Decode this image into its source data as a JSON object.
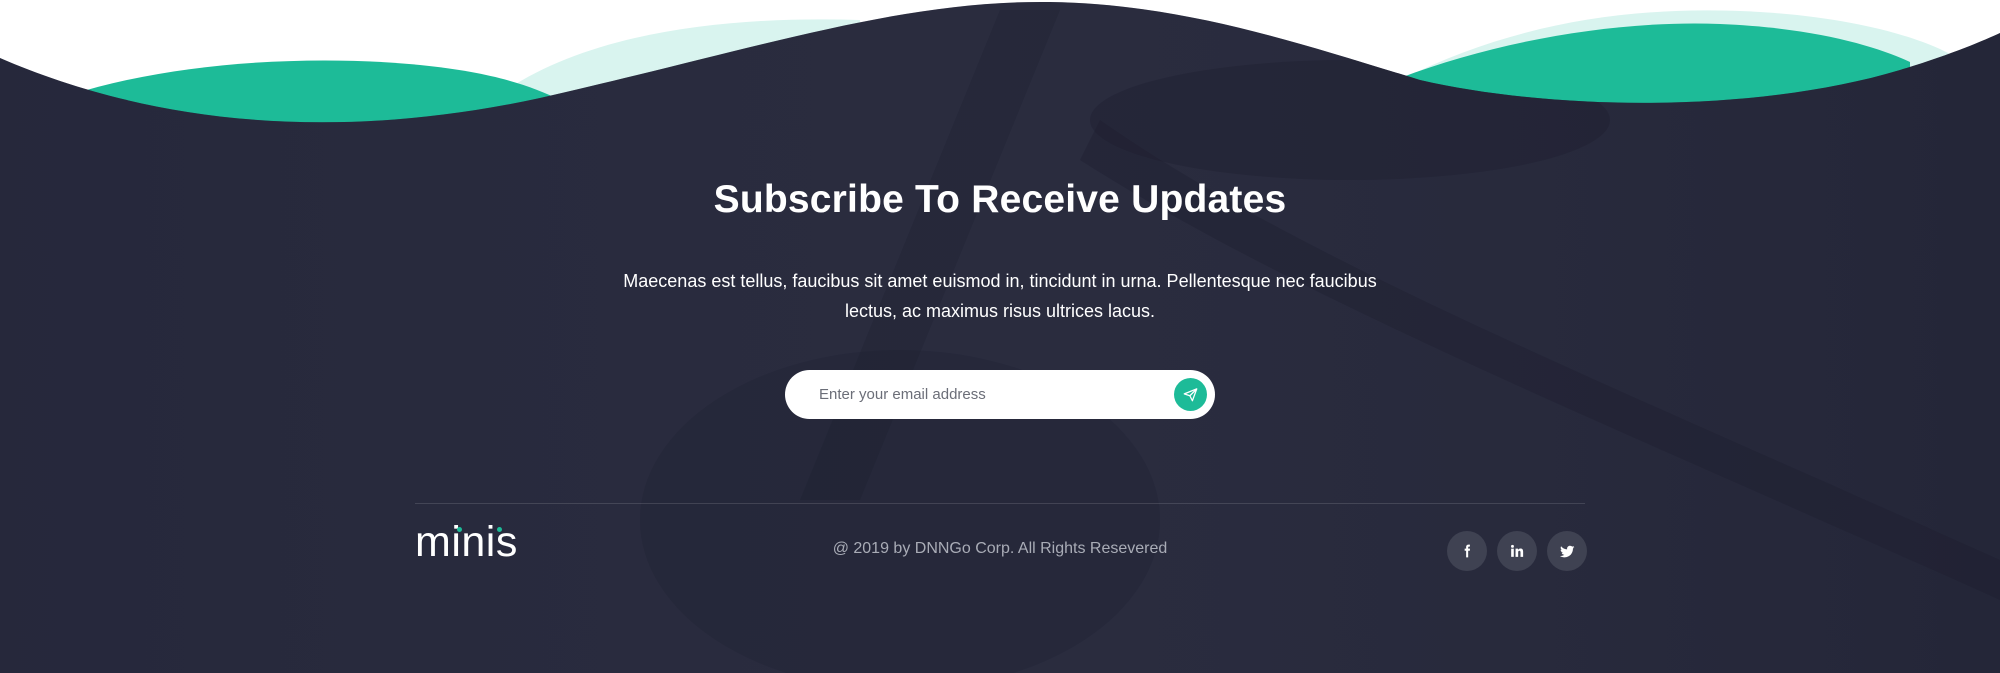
{
  "colors": {
    "background_dark": "#282a3c",
    "accent_teal": "#1dbb98",
    "light_teal": "#d7f3ee",
    "text_white": "#ffffff",
    "text_muted": "#a9acb6",
    "social_bg": "#3f4252"
  },
  "subscribe": {
    "title": "Subscribe To Receive Updates",
    "description": "Maecenas est tellus, faucibus sit amet euismod in, tincidunt in urna. Pellentesque nec faucibus lectus, ac maximus risus ultrices lacus.",
    "email_placeholder": "Enter your email address",
    "send_icon": "paper-plane-icon"
  },
  "footer": {
    "logo_text": "minis",
    "copyright": "@ 2019 by DNNGo Corp. All Rights Resevered",
    "socials": [
      {
        "name": "facebook",
        "icon": "facebook-icon",
        "glyph": "f"
      },
      {
        "name": "linkedin",
        "icon": "linkedin-icon",
        "glyph": "in"
      },
      {
        "name": "twitter",
        "icon": "twitter-icon",
        "glyph": "twitter-bird"
      }
    ]
  }
}
